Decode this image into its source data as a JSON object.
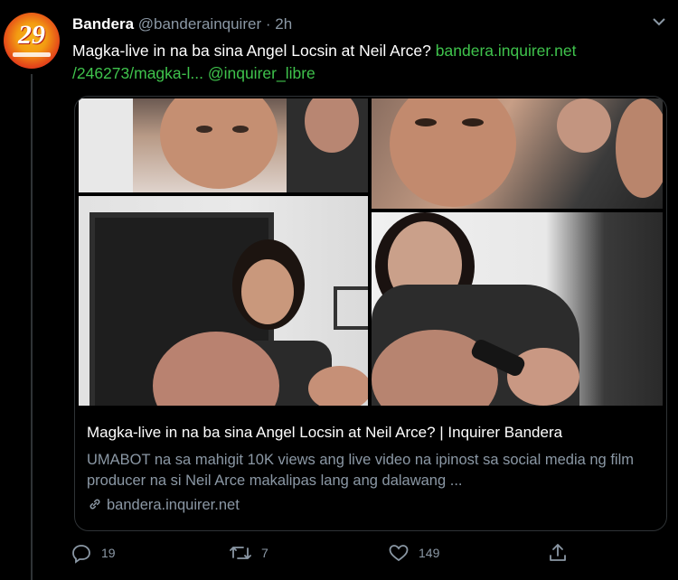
{
  "account": {
    "avatar_text": "29",
    "name": "Bandera",
    "handle": "@banderainquirer",
    "separator": "·",
    "time": "2h"
  },
  "tweet": {
    "text": "Magka-live in na ba sina Angel Locsin at Neil Arce?",
    "link_part1": "bandera.inquirer.net",
    "link_part2": "/246273/magka-l...",
    "mention": "@inquirer_libre"
  },
  "card": {
    "title": "Magka-live in na ba sina Angel Locsin at Neil Arce? | Inquirer Bandera",
    "description": "UMABOT na sa mahigit 10K views ang live video na ipinost sa social media ng film producer na si Neil Arce makalipas lang ang dalawang ...",
    "domain": "bandera.inquirer.net"
  },
  "actions": {
    "reply_count": "19",
    "retweet_count": "7",
    "like_count": "149"
  },
  "icons": [
    "chevron-down-icon",
    "reply-icon",
    "retweet-icon",
    "like-icon",
    "share-icon",
    "link-icon"
  ],
  "colors": {
    "link": "#3fc34c",
    "muted": "#8b98a5",
    "background": "#000000"
  }
}
